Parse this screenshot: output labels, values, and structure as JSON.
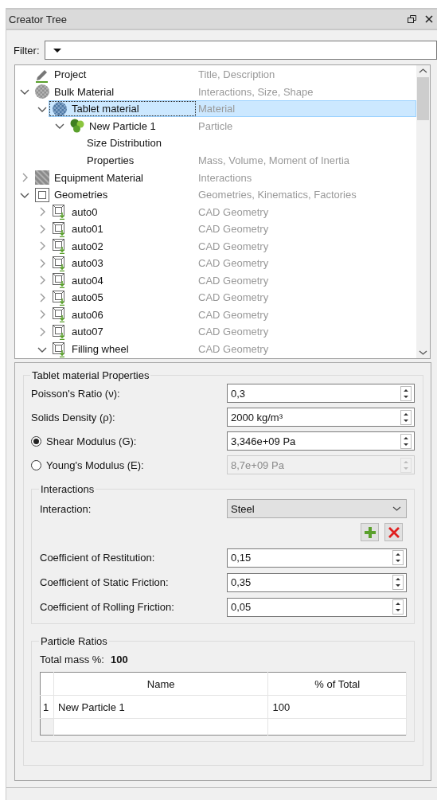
{
  "panel": {
    "title": "Creator Tree"
  },
  "filter": {
    "label": "Filter:"
  },
  "tree": {
    "items": [
      {
        "kind": "project",
        "label": "Project",
        "description": "Title, Description",
        "selected": false
      },
      {
        "kind": "bulk",
        "label": "Bulk Material",
        "description": "Interactions, Size, Shape",
        "expanded": true,
        "selected": false,
        "children": [
          {
            "kind": "material",
            "label": "Tablet material",
            "description": "Material",
            "expanded": true,
            "selected": true,
            "children": [
              {
                "kind": "particle",
                "label": "New Particle 1",
                "description": "Particle",
                "expanded": true,
                "selected": false,
                "children": [
                  {
                    "kind": "property",
                    "label": "Size Distribution",
                    "selected": false
                  },
                  {
                    "kind": "property",
                    "label": "Properties",
                    "description": "Mass, Volume, Moment of Inertia",
                    "selected": false
                  }
                ]
              }
            ]
          }
        ]
      },
      {
        "kind": "equipment",
        "label": "Equipment Material",
        "description": "Interactions",
        "expanded": false,
        "selected": false
      },
      {
        "kind": "geometries",
        "label": "Geometries",
        "description": "Geometries, Kinematics, Factories",
        "expanded": true,
        "selected": false,
        "children": [
          {
            "kind": "cad",
            "label": "auto0",
            "description": "CAD Geometry",
            "expanded": false,
            "selected": false
          },
          {
            "kind": "cad",
            "label": "auto01",
            "description": "CAD Geometry",
            "expanded": false,
            "selected": false
          },
          {
            "kind": "cad",
            "label": "auto02",
            "description": "CAD Geometry",
            "expanded": false,
            "selected": false
          },
          {
            "kind": "cad",
            "label": "auto03",
            "description": "CAD Geometry",
            "expanded": false,
            "selected": false
          },
          {
            "kind": "cad",
            "label": "auto04",
            "description": "CAD Geometry",
            "expanded": false,
            "selected": false
          },
          {
            "kind": "cad",
            "label": "auto05",
            "description": "CAD Geometry",
            "expanded": false,
            "selected": false
          },
          {
            "kind": "cad",
            "label": "auto06",
            "description": "CAD Geometry",
            "expanded": false,
            "selected": false
          },
          {
            "kind": "cad",
            "label": "auto07",
            "description": "CAD Geometry",
            "expanded": false,
            "selected": false
          },
          {
            "kind": "cad",
            "label": "Filling wheel",
            "description": "CAD Geometry",
            "expanded": true,
            "selected": false
          }
        ]
      }
    ]
  },
  "properties": {
    "title": "Tablet material Properties",
    "fields": [
      {
        "kind": "spin",
        "label": "Poisson's Ratio (ν):",
        "value": "0,3",
        "disabled": false
      },
      {
        "kind": "spin",
        "label": "Solids Density (ρ):",
        "value": "2000 kg/m³",
        "disabled": false
      },
      {
        "kind": "radio",
        "label": "Shear Modulus (G):",
        "value": "3,346e+09 Pa",
        "selected": true,
        "disabled": false
      },
      {
        "kind": "radio",
        "label": "Young's Modulus (E):",
        "value": "8,7e+09 Pa",
        "selected": false,
        "disabled": true
      }
    ],
    "interactions": {
      "title": "Interactions",
      "interaction": {
        "label": "Interaction:",
        "value": "Steel"
      },
      "fields": [
        {
          "kind": "spin",
          "label": "Coefficient of Restitution:",
          "value": "0,15",
          "disabled": false
        },
        {
          "kind": "spin",
          "label": "Coefficient of Static Friction:",
          "value": "0,35",
          "disabled": false
        },
        {
          "kind": "spin",
          "label": "Coefficient of Rolling Friction:",
          "value": "0,05",
          "disabled": false
        }
      ]
    },
    "ratios": {
      "title": "Particle Ratios",
      "total_label": "Total mass %:",
      "total_value": "100",
      "table": {
        "columns": [
          "Name",
          "% of Total"
        ],
        "rows": [
          {
            "index": "1",
            "cells": [
              "New Particle 1",
              "100"
            ]
          }
        ]
      }
    }
  }
}
